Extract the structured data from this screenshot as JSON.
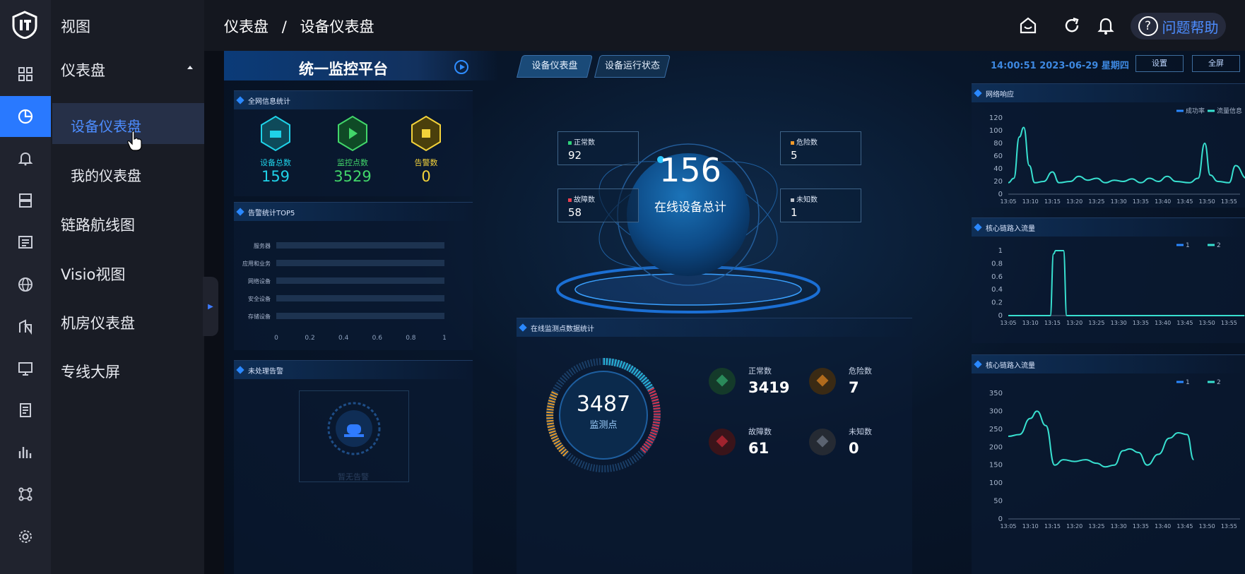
{
  "sidebar": {
    "section_title": "视图",
    "menu": [
      {
        "label": "仪表盘",
        "expanded": true
      },
      {
        "label": "链路航线图"
      },
      {
        "label": "Visio视图"
      },
      {
        "label": "机房仪表盘"
      },
      {
        "label": "专线大屏"
      }
    ],
    "submenu": [
      {
        "label": "设备仪表盘",
        "active": true
      },
      {
        "label": "我的仪表盘"
      }
    ],
    "rail_icons": [
      "grid-icon",
      "dashboard-icon",
      "bell-icon",
      "server-icon",
      "list-icon",
      "globe-icon",
      "building-icon",
      "monitor-icon",
      "document-icon",
      "bar-chart-icon",
      "topology-icon",
      "gear-icon"
    ],
    "rail_active_index": 1
  },
  "header": {
    "breadcrumb": [
      "仪表盘",
      "设备仪表盘"
    ],
    "separator": "/",
    "help_label": "问题帮助",
    "icons": [
      "home-icon",
      "refresh-icon",
      "bell-icon",
      "help-icon"
    ]
  },
  "dashboard": {
    "title": "统一监控平台",
    "tabs": [
      "设备仪表盘",
      "设备运行状态"
    ],
    "datetime": "14:00:51 2023-06-29 星期四",
    "settings_label": "设置",
    "fullscreen_label": "全屏",
    "overview": {
      "title": "全网信息统计",
      "stats": [
        {
          "label": "设备总数",
          "value": "159",
          "color": "#1fd2e8"
        },
        {
          "label": "监控点数",
          "value": "3529",
          "color": "#42d66a"
        },
        {
          "label": "告警数",
          "value": "0",
          "color": "#f3d23a"
        }
      ]
    },
    "alarm_top5": {
      "title": "告警统计TOP5",
      "categories": [
        "服务器",
        "应用和业务",
        "网络设备",
        "安全设备",
        "存储设备"
      ],
      "values": [
        0,
        0,
        0,
        0,
        0
      ],
      "x_ticks": [
        "0",
        "0.2",
        "0.4",
        "0.6",
        "0.8",
        "1"
      ]
    },
    "unhandled": {
      "title": "未处理告警",
      "empty_text": "暂无告警"
    },
    "center": {
      "total": "156",
      "total_label": "在线设备总计",
      "boxes": [
        {
          "label": "正常数",
          "value": "92",
          "color": "#2fd27a"
        },
        {
          "label": "危险数",
          "value": "5",
          "color": "#f39a2a"
        },
        {
          "label": "故障数",
          "value": "58",
          "color": "#e84050"
        },
        {
          "label": "未知数",
          "value": "1",
          "color": "#c0c4cc"
        }
      ]
    },
    "monitor_points": {
      "title": "在线监测点数据统计",
      "total": "3487",
      "total_label": "监测点",
      "items": [
        {
          "label": "正常数",
          "value": "3419",
          "color": "#2a8a5a"
        },
        {
          "label": "危险数",
          "value": "7",
          "color": "#b06a1c"
        },
        {
          "label": "故障数",
          "value": "61",
          "color": "#a0232e"
        },
        {
          "label": "未知数",
          "value": "0",
          "color": "#5a6270"
        }
      ]
    }
  },
  "chart_data": [
    {
      "type": "line",
      "title": "网络响应",
      "legend": [
        "成功率",
        "流量信息"
      ],
      "x": [
        "13:05",
        "13:10",
        "13:15",
        "13:20",
        "13:25",
        "13:30",
        "13:35",
        "13:40",
        "13:45",
        "13:50",
        "13:55"
      ],
      "yticks": [
        "0",
        "20",
        "40",
        "60",
        "80",
        "100",
        "120"
      ],
      "ylim": [
        0,
        120
      ],
      "series": [
        {
          "name": "成功率",
          "color": "#38e0d0",
          "points": [
            [
              0,
              18
            ],
            [
              0.25,
              25
            ],
            [
              0.5,
              90
            ],
            [
              0.7,
              105
            ],
            [
              0.95,
              45
            ],
            [
              1.2,
              18
            ],
            [
              1.6,
              20
            ],
            [
              2,
              35
            ],
            [
              2.3,
              18
            ],
            [
              2.8,
              20
            ],
            [
              3.2,
              28
            ],
            [
              3.6,
              22
            ],
            [
              4,
              25
            ],
            [
              4.4,
              18
            ],
            [
              4.8,
              22
            ],
            [
              5.2,
              20
            ],
            [
              5.6,
              24
            ],
            [
              6,
              18
            ],
            [
              6.4,
              25
            ],
            [
              6.8,
              20
            ],
            [
              7.2,
              28
            ],
            [
              7.6,
              20
            ],
            [
              8.2,
              18
            ],
            [
              8.6,
              25
            ],
            [
              8.9,
              80
            ],
            [
              9.15,
              30
            ],
            [
              9.5,
              20
            ],
            [
              10,
              18
            ],
            [
              10.3,
              45
            ],
            [
              10.8,
              25
            ]
          ]
        }
      ],
      "grid": false
    },
    {
      "type": "line",
      "title": "核心链路入流量",
      "legend": [
        "1",
        "2"
      ],
      "x": [
        "13:05",
        "13:10",
        "13:15",
        "13:20",
        "13:25",
        "13:30",
        "13:35",
        "13:40",
        "13:45",
        "13:50",
        "13:55"
      ],
      "yticks": [
        "0",
        "0.2",
        "0.4",
        "0.6",
        "0.8",
        "1"
      ],
      "ylim": [
        0,
        1
      ],
      "series": [
        {
          "name": "1",
          "color": "#38e0d0",
          "points": [
            [
              0,
              0
            ],
            [
              1.9,
              0
            ],
            [
              2.05,
              0.95
            ],
            [
              2.15,
              1
            ],
            [
              2.5,
              1
            ],
            [
              2.65,
              0
            ],
            [
              10.7,
              0
            ]
          ]
        }
      ],
      "grid": false
    },
    {
      "type": "line",
      "title": "核心链路入流量",
      "legend": [
        "1",
        "2"
      ],
      "x": [
        "13:05",
        "13:10",
        "13:15",
        "13:20",
        "13:25",
        "13:30",
        "13:35",
        "13:40",
        "13:45",
        "13:50",
        "13:55"
      ],
      "yticks": [
        "0",
        "50",
        "100",
        "150",
        "200",
        "250",
        "300",
        "350"
      ],
      "ylim": [
        0,
        350
      ],
      "series": [
        {
          "name": "1",
          "color": "#38e0d0",
          "points": [
            [
              0,
              230
            ],
            [
              0.5,
              235
            ],
            [
              1,
              280
            ],
            [
              1.3,
              300
            ],
            [
              1.7,
              260
            ],
            [
              2.1,
              150
            ],
            [
              2.5,
              165
            ],
            [
              3,
              160
            ],
            [
              3.5,
              165
            ],
            [
              4,
              155
            ],
            [
              4.4,
              145
            ],
            [
              4.8,
              150
            ],
            [
              5.2,
              190
            ],
            [
              5.5,
              195
            ],
            [
              5.9,
              185
            ],
            [
              6.3,
              150
            ],
            [
              6.8,
              180
            ],
            [
              7.3,
              225
            ],
            [
              7.7,
              240
            ],
            [
              8.1,
              235
            ],
            [
              8.4,
              165
            ]
          ]
        }
      ],
      "grid": false
    }
  ]
}
